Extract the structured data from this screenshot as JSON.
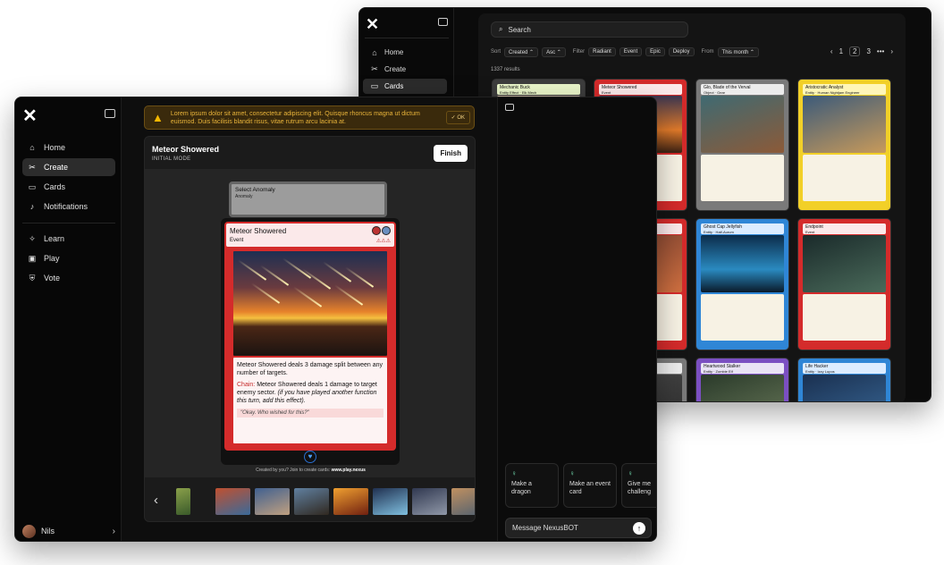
{
  "back_window": {
    "logo": "✕",
    "nav": [
      {
        "label": "Home",
        "icon": "home-icon",
        "glyph": "⌂"
      },
      {
        "label": "Create",
        "icon": "sparkle-icon",
        "glyph": "✂"
      },
      {
        "label": "Cards",
        "icon": "cards-icon",
        "glyph": "▭"
      }
    ],
    "search_placeholder": "Search",
    "filters": {
      "sort_label": "Sort",
      "sort_by": "Created",
      "order": "Asc",
      "filter_label": "Filter",
      "chips": [
        "Radiant",
        "Event",
        "Epic",
        "Deploy"
      ],
      "from_label": "From",
      "from_value": "This month"
    },
    "pager": {
      "prev": "‹",
      "pages": [
        "1",
        "2",
        "3"
      ],
      "current": "2",
      "more": "•••",
      "next": "›"
    },
    "results": "1337 results",
    "cards": [
      {
        "name": "Mechanic Buck",
        "type": "Entity Effect · Elk Mech",
        "head_color": "#e9f5c9",
        "frame_color": "#3d3d3d",
        "art": "linear-gradient(160deg,#c9b6a0,#6d6a6e)"
      },
      {
        "name": "Meteor Showered",
        "type": "Event",
        "head_color": "#fbe9ea",
        "frame_color": "#d42b2b",
        "art": "linear-gradient(180deg,#3a3550,#e07a2a 60%,#3b2114)"
      },
      {
        "name": "Glo, Blade of the Verval",
        "type": "Object · Gear",
        "head_color": "#ececec",
        "frame_color": "#7a7a7a",
        "art": "linear-gradient(160deg,#3f6a72,#8c5a38)"
      },
      {
        "name": "Aristocratic Analyst",
        "type": "Entity · Human Nightjam Engineer",
        "head_color": "#fff6b8",
        "frame_color": "#f2d028",
        "art": "linear-gradient(160deg,#3b5a7a,#c89a5a)"
      },
      {
        "name": "",
        "type": "",
        "head_color": "#fff6b8",
        "frame_color": "#f2d028",
        "art": "linear-gradient(160deg,#c8b040,#6b7a3a)"
      },
      {
        "name": "",
        "type": "",
        "head_color": "#fbe9ea",
        "frame_color": "#d42b2b",
        "art": "linear-gradient(160deg,#7a4030,#d07040)"
      },
      {
        "name": "Ghost Cap Jellyfish",
        "type": "Entity · Half-Aurum",
        "head_color": "#dcecff",
        "frame_color": "#2f86d6",
        "art": "linear-gradient(180deg,#0c2c4a,#2a8ac0 60%,#0a1a2a)"
      },
      {
        "name": "Endpoint",
        "type": "Event",
        "head_color": "#fbe9ea",
        "frame_color": "#d42b2b",
        "art": "linear-gradient(160deg,#1a2a2a,#4a6a5a)"
      },
      {
        "name": "",
        "type": "",
        "head_color": "#e6f5c0",
        "frame_color": "#7fbf3a",
        "art": "linear-gradient(160deg,#3a5a2a,#9ab04a)"
      },
      {
        "name": "",
        "type": "",
        "head_color": "#ececec",
        "frame_color": "#7a7a7a",
        "art": "linear-gradient(160deg,#4a4a4a,#2a2a2a)"
      },
      {
        "name": "Heartwood Stalker",
        "type": "Entity · Zombie Elf",
        "head_color": "#e9e3f5",
        "frame_color": "#7b4fc2",
        "art": "linear-gradient(160deg,#2a3a2a,#6a7a5a)"
      },
      {
        "name": "Life Hacker",
        "type": "Entity · Izzy Lupos",
        "head_color": "#dcecff",
        "frame_color": "#2f86d6",
        "art": "linear-gradient(160deg,#1a3050,#3a6a9a)"
      }
    ]
  },
  "front_window": {
    "logo": "✕",
    "nav_top": [
      {
        "label": "Home",
        "icon": "home-icon",
        "glyph": "⌂"
      },
      {
        "label": "Create",
        "icon": "sparkle-icon",
        "glyph": "✂"
      },
      {
        "label": "Cards",
        "icon": "cards-icon",
        "glyph": "▭"
      },
      {
        "label": "Notifications",
        "icon": "bell-icon",
        "glyph": "♪"
      }
    ],
    "nav_bottom": [
      {
        "label": "Learn",
        "icon": "bulb-icon",
        "glyph": "✧"
      },
      {
        "label": "Play",
        "icon": "play-icon",
        "glyph": "▣"
      },
      {
        "label": "Vote",
        "icon": "ballot-icon",
        "glyph": "⛨"
      }
    ],
    "user": {
      "name": "Nils",
      "chevron": "›"
    },
    "warning": {
      "icon": "▲",
      "text": "Lorem ipsum dolor sit amet, consectetur adipiscing elit. Quisque rhoncus magna ut dictum euismod. Duis facilisis blandit risus, vitae rutrum arcu lacinia at.",
      "ok_label": "✓ OK"
    },
    "editor": {
      "title": "Meteor Showered",
      "mode": "INITIAL MODE",
      "finish_label": "Finish",
      "ghost_name": "Select Anomaly",
      "ghost_type": "Anomaly",
      "card": {
        "name": "Meteor Showered",
        "type": "Event",
        "rarity": "⚠⚠⚠",
        "text1": "Meteor Showered deals 3 damage split between any number of targets.",
        "chain_label": "Chain:",
        "text2": "Meteor Showered deals 1 damage to target enemy sector.",
        "text2_italic": "(if you have played another function this turn, add this effect).",
        "flavor": "\"Okay. Who wished for this?\""
      },
      "credit_prefix": "Created by you? Join to create cards:",
      "credit_link": "www.play.nexus",
      "prev_arrow": "‹",
      "next_arrow": "›",
      "thumbnails": [
        "linear-gradient(160deg,#8aa04a,#3a5a2a)",
        "linear-gradient(160deg,#c05030,#3a6a9a)",
        "linear-gradient(160deg,#406090,#c0a080)",
        "linear-gradient(160deg,#6080a0,#302820)",
        "linear-gradient(160deg,#f0a030,#702010)",
        "linear-gradient(160deg,#203050,#80c0e0)",
        "linear-gradient(160deg,#303850,#9098a8)",
        "linear-gradient(160deg,#c09060,#506070)",
        "linear-gradient(160deg,#6a8a3a,#2a3a1a)"
      ]
    },
    "chat": {
      "suggestions": [
        "Make a dragon",
        "Make an event card",
        "Give me challeng"
      ],
      "message_placeholder": "Message NexusBOT",
      "send_icon": "↑"
    }
  }
}
